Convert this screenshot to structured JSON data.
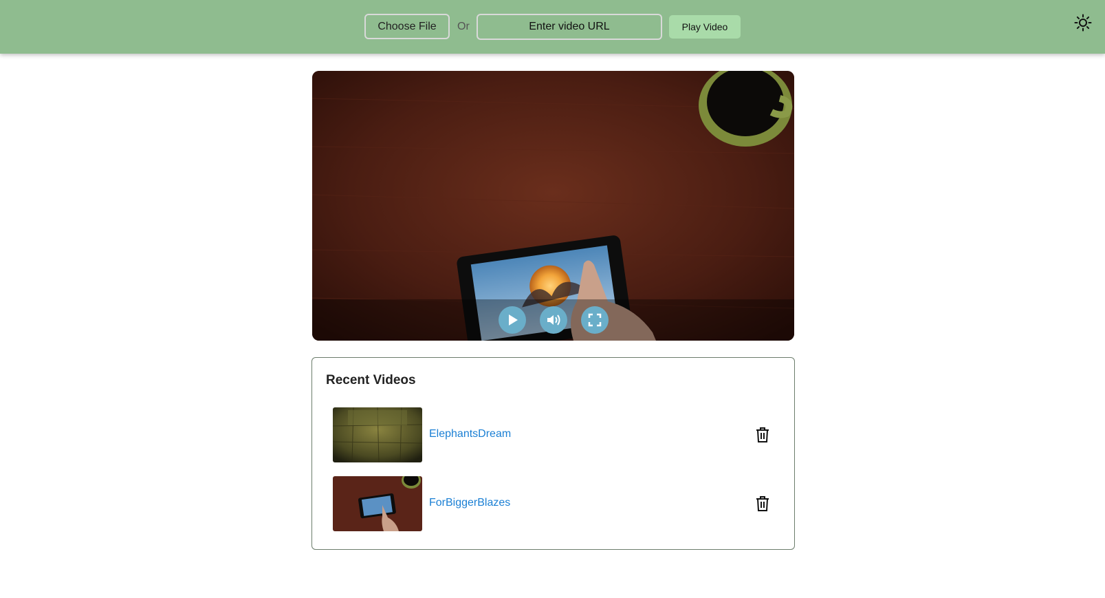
{
  "header": {
    "choose_file_label": "Choose File",
    "or_label": "Or",
    "url_placeholder": "Enter video URL",
    "play_button_label": "Play Video",
    "theme_icon": "sun-icon"
  },
  "player": {
    "controls": {
      "play_icon": "play-icon",
      "volume_icon": "volume-icon",
      "fullscreen_icon": "fullscreen-icon"
    }
  },
  "recent": {
    "title": "Recent Videos",
    "items": [
      {
        "title": "ElephantsDream",
        "delete_icon": "trash-icon"
      },
      {
        "title": "ForBiggerBlazes",
        "delete_icon": "trash-icon"
      }
    ]
  },
  "colors": {
    "header_bg": "#8fbc8f",
    "play_button_bg": "#a9dba9",
    "control_button_bg": "#6aaec9",
    "link_color": "#1a7fd4"
  }
}
